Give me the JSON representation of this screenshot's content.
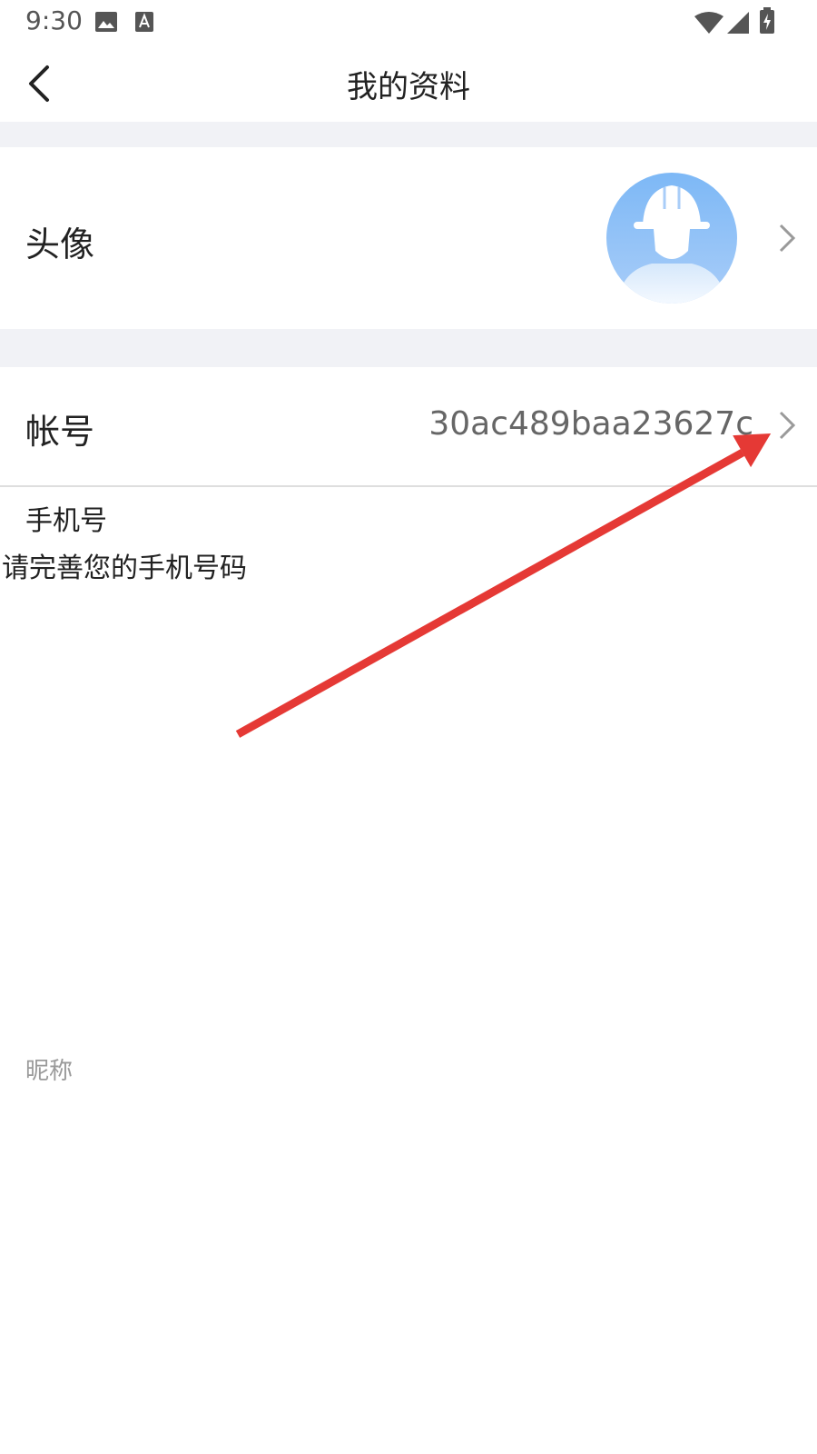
{
  "status_bar": {
    "time": "9:30"
  },
  "header": {
    "title": "我的资料"
  },
  "rows": {
    "avatar": {
      "label": "头像"
    },
    "account": {
      "label": "帐号",
      "value": "30ac489baa23627c"
    },
    "phone": {
      "label": "手机号",
      "hint": "请完善您的手机号码"
    },
    "nickname": {
      "label": "昵称"
    }
  },
  "colors": {
    "accent_arrow": "#e53935",
    "avatar_blue": "#7fb9f6",
    "section_gap": "#f1f2f6"
  },
  "icons": {
    "back": "chevron-left-icon",
    "row_arrow": "chevron-right-icon",
    "avatar": "helmet-worker-avatar-icon"
  }
}
